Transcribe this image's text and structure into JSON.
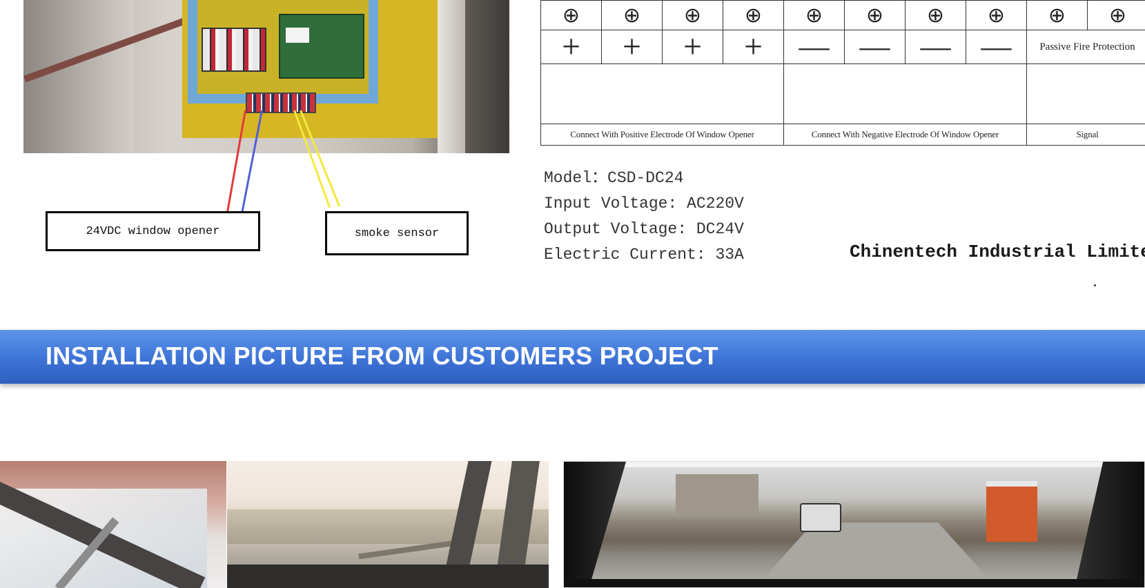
{
  "wiring_diagram": {
    "labels": {
      "opener": "24VDC window opener",
      "sensor": "smoke sensor"
    }
  },
  "terminal_table": {
    "screw_symbol": "⊕",
    "poles": {
      "positive": "+",
      "negative": "—",
      "passive": "Passive Fire Protection"
    },
    "descriptions": {
      "positive": "Connect With Positive Electrode Of Window Opener",
      "negative": "Connect With Negative Electrode Of Window Opener",
      "signal": "Signal"
    }
  },
  "specs": {
    "model": "Model：CSD-DC24",
    "input": "Input Voltage: AC220V",
    "output": "Output Voltage: DC24V",
    "current": "Electric Current: 33A"
  },
  "company": "Chinentech Industrial Limited",
  "section": {
    "title": "INSTALLATION PICTURE FROM CUSTOMERS PROJECT"
  },
  "colors": {
    "banner": "#3d73d6",
    "banner_text": "#ffffff",
    "wire_red": "#e03b3b",
    "wire_blue": "#5060d8",
    "wire_yellow": "#f2ea3c"
  }
}
